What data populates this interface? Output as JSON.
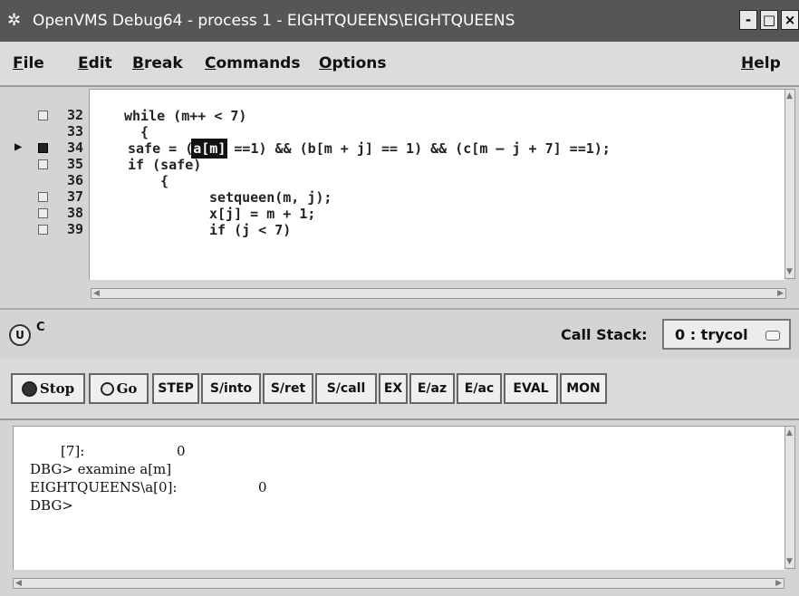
{
  "window": {
    "title": "OpenVMS Debug64 - process 1 - EIGHTQUEENS\\EIGHTQUEENS",
    "icon": "debugger-app-icon",
    "controls": [
      "-",
      "□",
      "×"
    ]
  },
  "menu": {
    "file": {
      "accel": "F",
      "rest": "ile"
    },
    "edit": {
      "accel": "E",
      "rest": "dit"
    },
    "break": {
      "accel": "B",
      "rest": "reak"
    },
    "commands": {
      "accel": "C",
      "rest": "ommands"
    },
    "options": {
      "accel": "O",
      "rest": "ptions"
    },
    "help": {
      "accel": "H",
      "rest": "elp"
    }
  },
  "source": {
    "lines": [
      {
        "num": "32",
        "breakpoint": true,
        "code": "while (m++ < 7)"
      },
      {
        "num": "33",
        "breakpoint": false,
        "code": "  {"
      },
      {
        "num": "34",
        "breakpoint": true,
        "current": true,
        "code_pre": "safe = (",
        "code_hl": "a[m]",
        "code_post": " ==1) && (b[m + j] == 1) && (c[m – j + 7] ==1);"
      },
      {
        "num": "35",
        "breakpoint": true,
        "code": "if (safe)"
      },
      {
        "num": "36",
        "breakpoint": false,
        "code": "  {"
      },
      {
        "num": "37",
        "breakpoint": true,
        "code": "setqueen(m, j);"
      },
      {
        "num": "38",
        "breakpoint": true,
        "code": "x[j] = m + 1;"
      },
      {
        "num": "39",
        "breakpoint": true,
        "code": "if (j < 7)"
      }
    ]
  },
  "status": {
    "badge": "U",
    "indicator": "C",
    "call_stack_label": "Call Stack:",
    "call_stack_value": "0 : trycol"
  },
  "toolbar": {
    "stop": "Stop",
    "go": "Go",
    "step": "STEP",
    "s_into": "S/into",
    "s_ret": "S/ret",
    "s_call": "S/call",
    "ex": "EX",
    "e_az": "E/az",
    "e_ac": "E/ac",
    "eval": "EVAL",
    "mon": "MON"
  },
  "console": {
    "lines": [
      {
        "label": "[7]:",
        "value": "0"
      },
      {
        "text": "DBG> examine a[m]"
      },
      {
        "label": "EIGHTQUEENS\\a[0]:",
        "value": "0"
      },
      {
        "text": "DBG>"
      }
    ]
  }
}
